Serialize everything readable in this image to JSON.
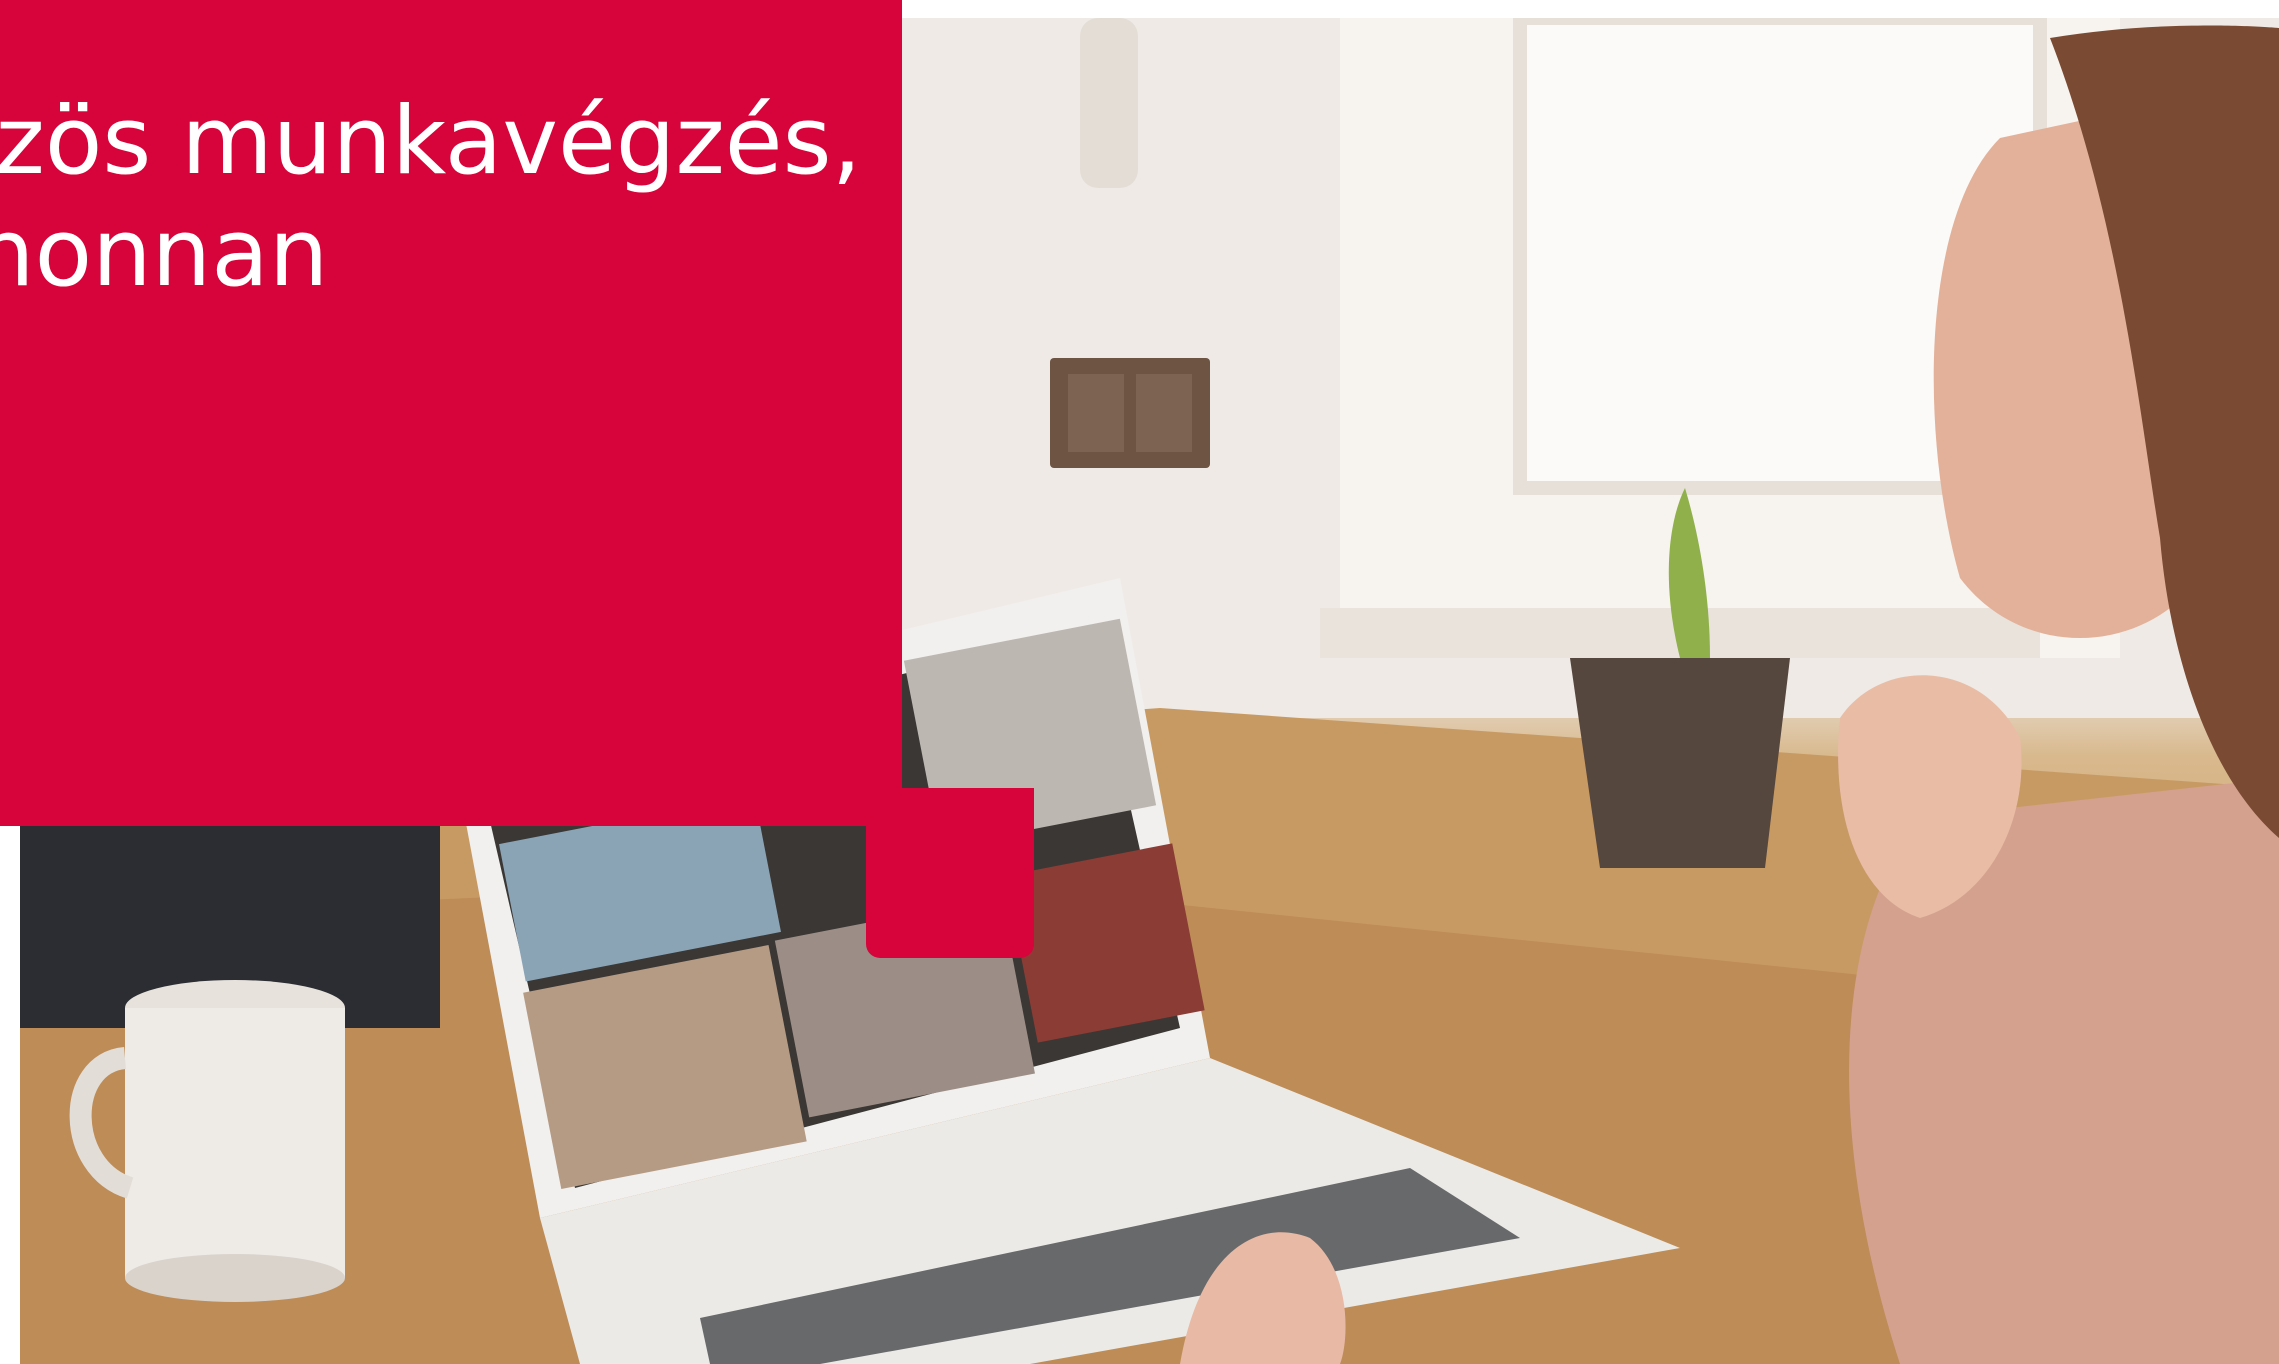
{
  "headline": {
    "line1": "özös munkavégzés,",
    "line2": "rhonnan"
  },
  "colors": {
    "brand_red": "#d6043a",
    "text": "#ffffff"
  },
  "photo": {
    "subject": "woman on video call with laptop at wooden table"
  }
}
